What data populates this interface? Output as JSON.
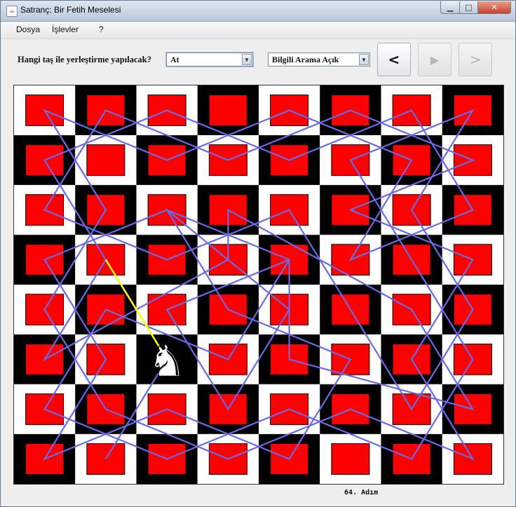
{
  "window": {
    "title": "Satranç: Bir Fetih Meselesi",
    "app_icon": "java-cup-icon",
    "buttons": {
      "minimize": "▁",
      "maximize": "□",
      "close": "✕"
    }
  },
  "menu": [
    {
      "label": "Dosya"
    },
    {
      "label": "İşlevler"
    },
    {
      "label": "?"
    }
  ],
  "toolbar": {
    "piece_label": "Hangi taş ile yerleştirme yapılacak?",
    "piece_select": {
      "selected": "At"
    },
    "search_select": {
      "selected": "Bilgili Arama Açık"
    },
    "back_label": "<",
    "play_label": "▶",
    "next_label": ">",
    "play_enabled": false,
    "next_enabled": false
  },
  "board": {
    "size": 8,
    "light_color": "#ffffff",
    "dark_color": "#000000",
    "marker_color": "#ff0000",
    "path_color": "#6a6ae8",
    "last_move_color": "#ffff00",
    "piece": {
      "name": "knight",
      "glyph": "♞",
      "square": [
        5,
        2
      ]
    },
    "tour": [
      [
        7,
        1
      ],
      [
        5,
        2
      ],
      [
        3,
        1
      ],
      [
        1,
        0
      ],
      [
        0,
        2
      ],
      [
        1,
        4
      ],
      [
        0,
        6
      ],
      [
        2,
        7
      ],
      [
        3,
        5
      ],
      [
        1,
        6
      ],
      [
        0,
        4
      ],
      [
        1,
        2
      ],
      [
        0,
        0
      ],
      [
        2,
        1
      ],
      [
        4,
        0
      ],
      [
        6,
        1
      ],
      [
        7,
        3
      ],
      [
        6,
        5
      ],
      [
        7,
        7
      ],
      [
        5,
        6
      ],
      [
        3,
        7
      ],
      [
        2,
        5
      ],
      [
        1,
        7
      ],
      [
        0,
        5
      ],
      [
        1,
        3
      ],
      [
        0,
        1
      ],
      [
        2,
        0
      ],
      [
        3,
        2
      ],
      [
        2,
        4
      ],
      [
        4,
        5
      ],
      [
        6,
        6
      ],
      [
        4,
        7
      ],
      [
        2,
        6
      ],
      [
        0,
        7
      ],
      [
        1,
        5
      ],
      [
        3,
        6
      ],
      [
        5,
        7
      ],
      [
        7,
        6
      ],
      [
        6,
        4
      ],
      [
        7,
        2
      ],
      [
        6,
        0
      ],
      [
        4,
        1
      ],
      [
        5,
        3
      ],
      [
        3,
        4
      ],
      [
        2,
        2
      ],
      [
        4,
        3
      ],
      [
        5,
        5
      ],
      [
        7,
        4
      ],
      [
        6,
        2
      ],
      [
        7,
        0
      ],
      [
        5,
        1
      ],
      [
        3,
        0
      ],
      [
        2,
        2
      ],
      [
        4,
        4
      ],
      [
        6,
        3
      ],
      [
        4,
        2
      ],
      [
        3,
        4
      ],
      [
        5,
        4
      ],
      [
        6,
        7
      ],
      [
        4,
        6
      ],
      [
        2,
        3
      ],
      [
        3,
        3
      ],
      [
        5,
        0
      ],
      [
        3,
        1
      ]
    ],
    "last_move": [
      [
        3,
        1
      ],
      [
        5,
        2
      ]
    ]
  },
  "status": {
    "step_text": "64. Adım"
  }
}
